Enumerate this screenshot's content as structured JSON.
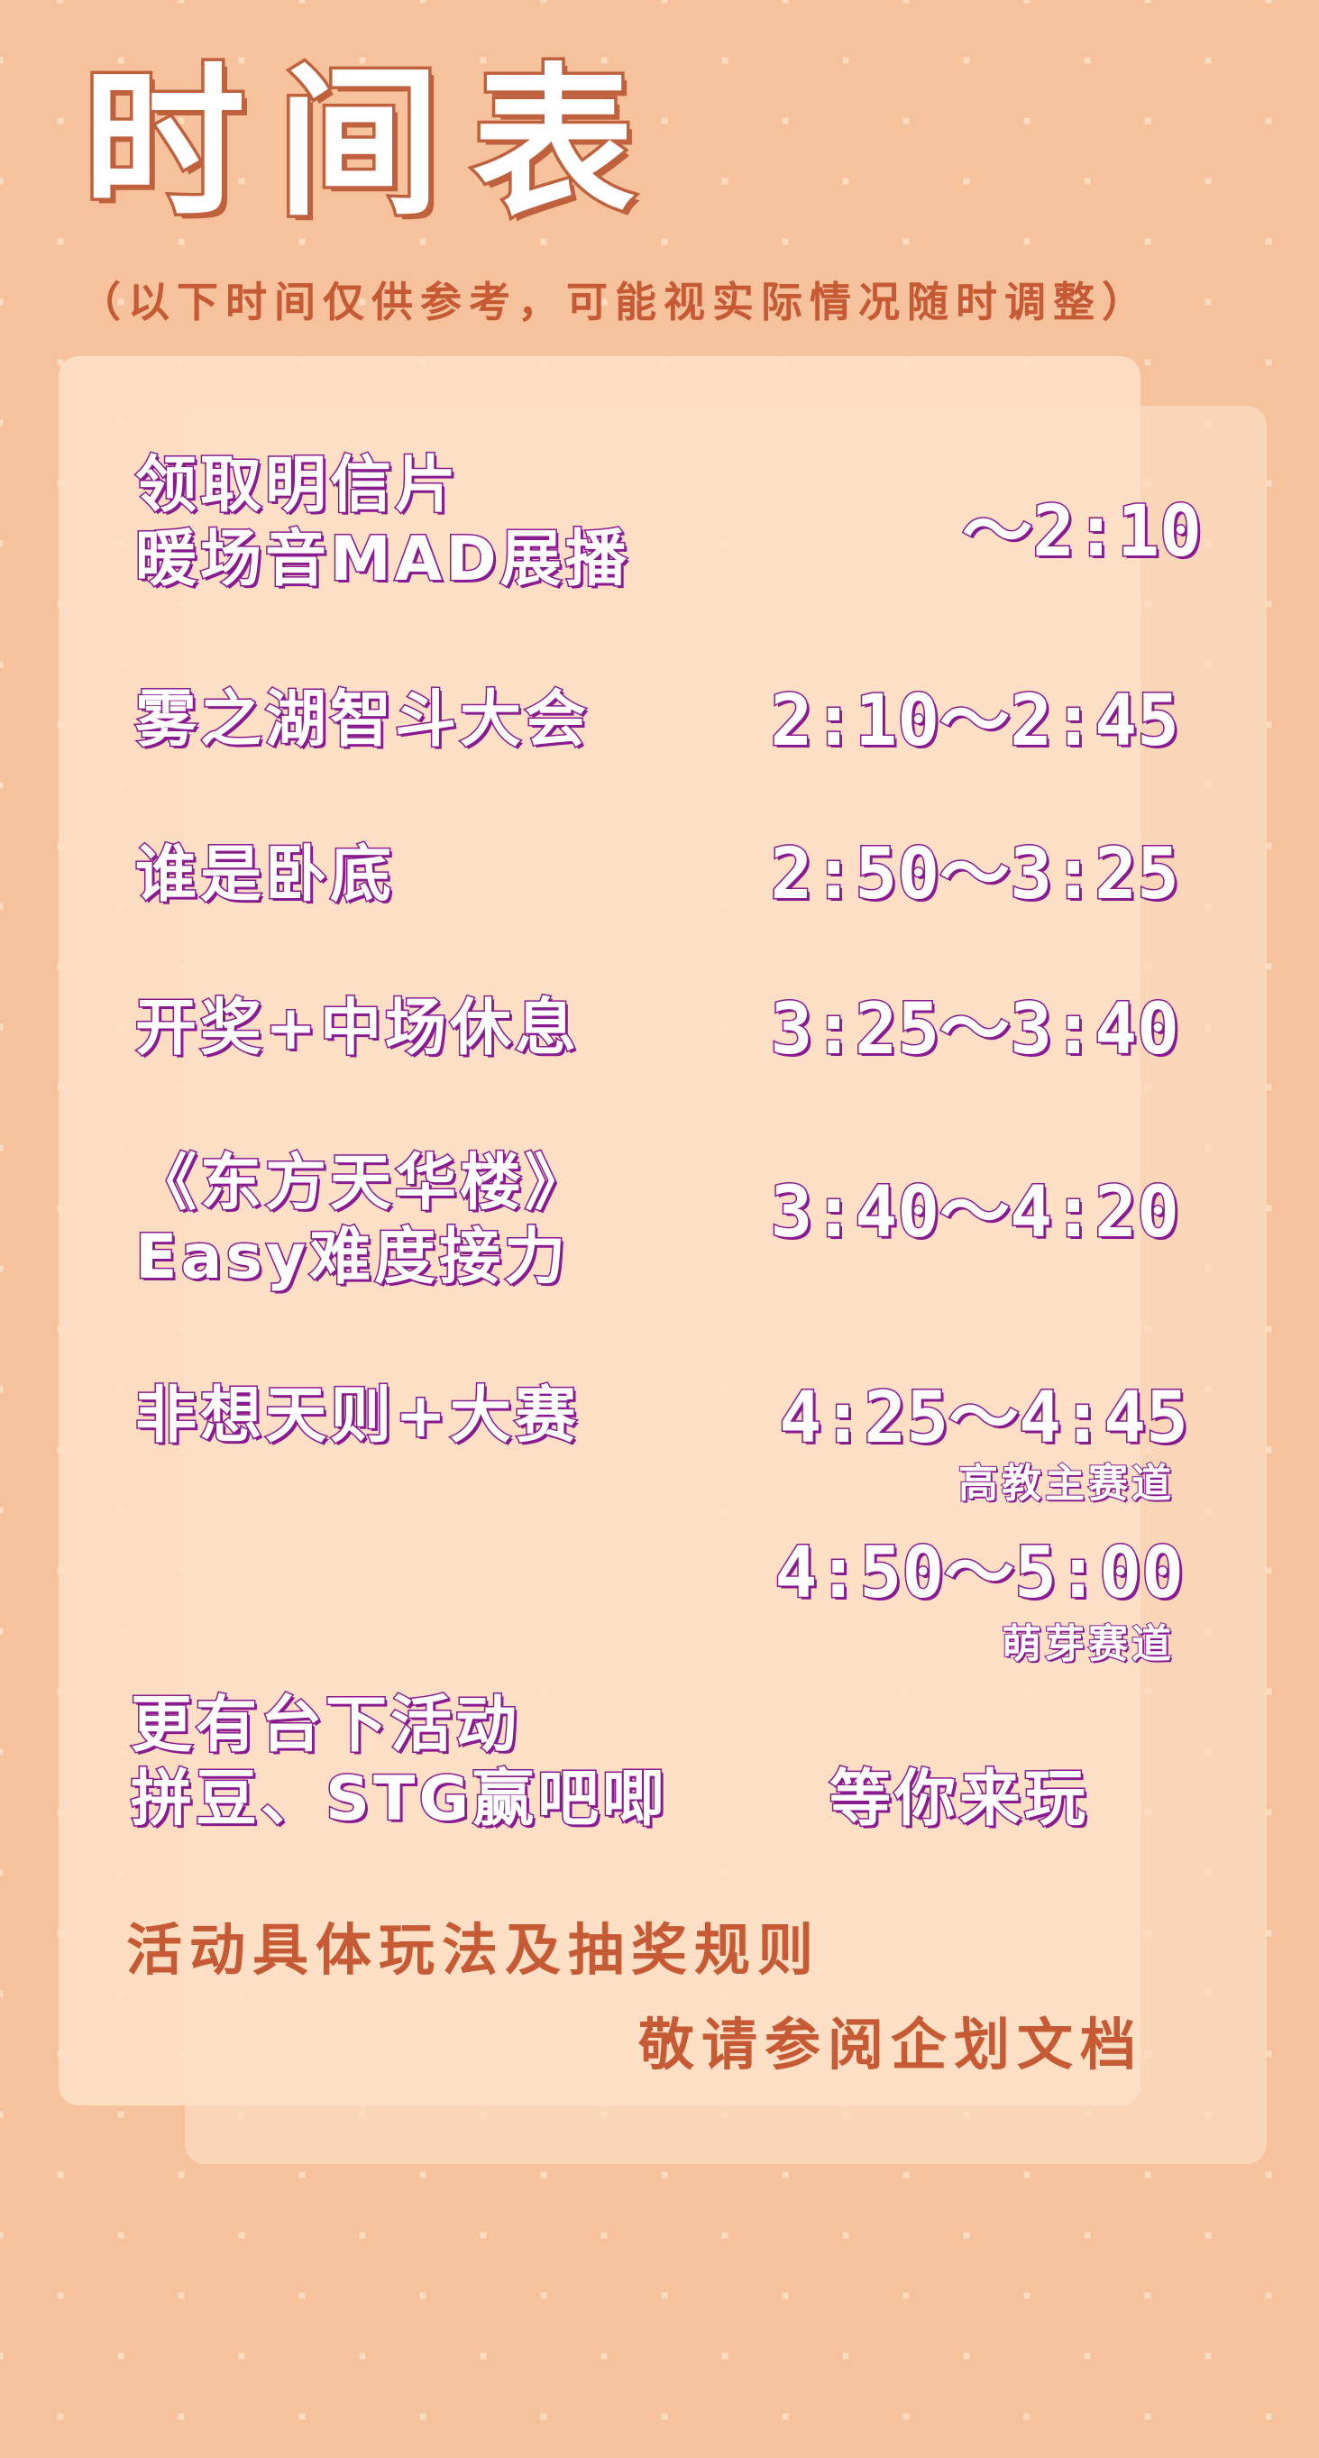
{
  "header": {
    "title": "时间表",
    "subtitle": "（以下时间仅供参考，可能视实际情况随时调整）"
  },
  "schedule": [
    {
      "label_lines": [
        "领取明信片",
        "暖场音MAD展播"
      ],
      "time": "～2:10"
    },
    {
      "label_lines": [
        "雾之湖智斗大会"
      ],
      "time": "2:10～2:45"
    },
    {
      "label_lines": [
        "谁是卧底"
      ],
      "time": "2:50～3:25"
    },
    {
      "label_lines": [
        "开奖+中场休息"
      ],
      "time": "3:25～3:40"
    },
    {
      "label_lines": [
        "《东方天华楼》",
        "Easy难度接力"
      ],
      "time": "3:40～4:20"
    },
    {
      "label_lines": [
        "非想天则+大赛"
      ],
      "time": "4:25～4:45",
      "note": "高教主赛道"
    },
    {
      "label_lines": [],
      "time": "4:50～5:00",
      "note": "萌芽赛道"
    }
  ],
  "offstage": {
    "line1": "更有台下活动",
    "line2": "拼豆、STG赢吧唧",
    "invite": "等你来玩"
  },
  "footer": {
    "line1": "活动具体玩法及抽奖规则",
    "line2": "敬请参阅企划文档"
  },
  "colors": {
    "background": "#fbdcc0",
    "dots": "#f5c29c",
    "accent_orange": "#c55a34",
    "accent_purple": "#8a1a8f"
  }
}
